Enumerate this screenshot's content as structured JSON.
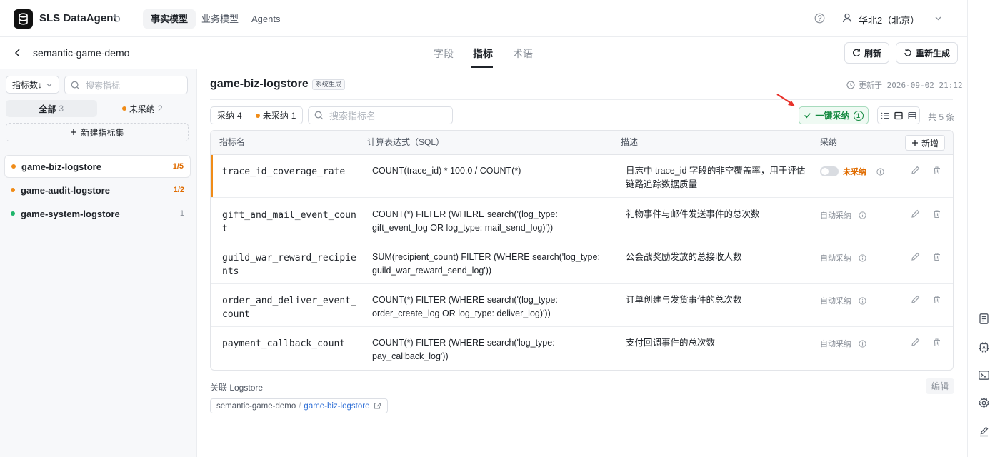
{
  "app": {
    "title": "SLS DataAgent"
  },
  "nav": {
    "tabs": [
      "事实模型",
      "业务模型",
      "Agents"
    ],
    "active": 0
  },
  "region": {
    "label": "华北2（北京）"
  },
  "model": {
    "name": "semantic-game-demo"
  },
  "subtabs": {
    "items": [
      "字段",
      "指标",
      "术语"
    ],
    "active": 1
  },
  "actions": {
    "refresh": "刷新",
    "regenerate": "重新生成"
  },
  "sidebar": {
    "sort_label": "指标数↓",
    "search_placeholder": "搜索指标",
    "segments": [
      {
        "label": "全部",
        "count": "3"
      },
      {
        "label": "未采纳",
        "count": "2"
      }
    ],
    "new_set_label": "新建指标集",
    "logstores": [
      {
        "name": "game-biz-logstore",
        "count": "1/5",
        "dot": "#f08c18",
        "count_color": "#e06c00"
      },
      {
        "name": "game-audit-logstore",
        "count": "1/2",
        "dot": "#f08c18",
        "count_color": "#e06c00"
      },
      {
        "name": "game-system-logstore",
        "count": "1",
        "dot": "#1fb56b",
        "count_color": "#8a9099"
      }
    ]
  },
  "main": {
    "title": "game-biz-logstore",
    "badge": "系统生成",
    "updated": "更新于 2026-09-02 21:12",
    "filters": [
      {
        "label": "采纳",
        "count": "4"
      },
      {
        "label": "未采纳",
        "count": "1"
      }
    ],
    "search_placeholder": "搜索指标名",
    "accept_all_label": "一键采纳",
    "accept_all_count": "1",
    "total": "共 5 条"
  },
  "table": {
    "headers": {
      "name": "指标名",
      "sql": "计算表达式（SQL）",
      "desc": "描述",
      "accept": "采纳",
      "add": "新增"
    },
    "rows": [
      {
        "name": "trace_id_coverage_rate",
        "sql": "COUNT(trace_id) * 100.0 / COUNT(*)",
        "desc": "日志中 trace_id 字段的非空覆盖率，用于评估链路追踪数据质量",
        "status": "未采纳"
      },
      {
        "name": "gift_and_mail_event_count",
        "sql": "COUNT(*) FILTER (WHERE search('(log_type: gift_event_log OR log_type: mail_send_log)'))",
        "desc": "礼物事件与邮件发送事件的总次数",
        "status": "自动采纳"
      },
      {
        "name": "guild_war_reward_recipients",
        "sql": "SUM(recipient_count) FILTER (WHERE search('log_type: guild_war_reward_send_log'))",
        "desc": "公会战奖励发放的总接收人数",
        "status": "自动采纳"
      },
      {
        "name": "order_and_deliver_event_count",
        "sql": "COUNT(*) FILTER (WHERE search('(log_type: order_create_log OR log_type: deliver_log)'))",
        "desc": "订单创建与发货事件的总次数",
        "status": "自动采纳"
      },
      {
        "name": "payment_callback_count",
        "sql": "COUNT(*) FILTER (WHERE search('log_type: pay_callback_log'))",
        "desc": "支付回调事件的总次数",
        "status": "自动采纳"
      }
    ]
  },
  "footer": {
    "assoc_label": "关联 Logstore",
    "edit_label": "编辑",
    "crumb_project": "semantic-game-demo",
    "crumb_sep": "/",
    "crumb_logstore": "game-biz-logstore"
  },
  "colors": {
    "accent_orange": "#f08c18",
    "accept_green": "#13893f",
    "link_blue": "#2f6fd6"
  }
}
